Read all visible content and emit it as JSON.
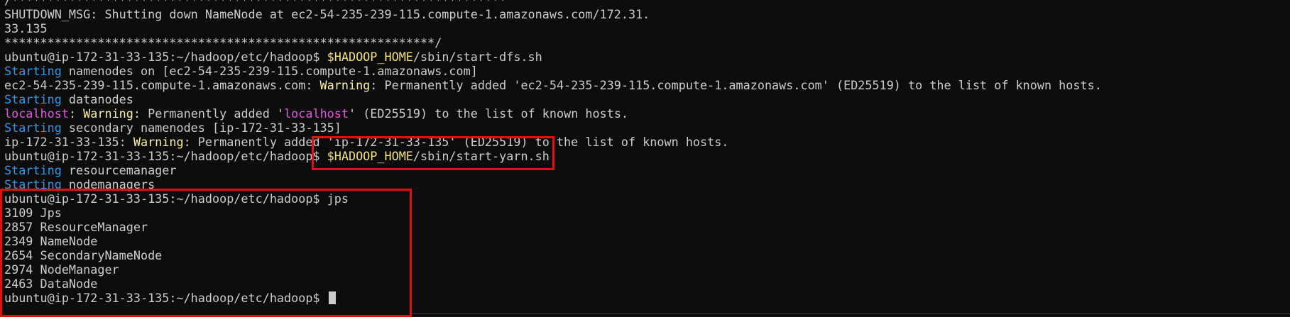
{
  "terminal": {
    "lines": [
      [
        {
          "t": "/*********************************************************************",
          "c": "fg"
        }
      ],
      [
        {
          "t": "SHUTDOWN_MSG: Shutting down NameNode at ec2-54-235-239-115.compute-1.amazonaws.com/172.31.",
          "c": "fg"
        }
      ],
      [
        {
          "t": "33.135",
          "c": "fg"
        }
      ],
      [
        {
          "t": "************************************************************/",
          "c": "fg"
        }
      ],
      [
        {
          "t": "ubuntu@ip-172-31-33-135:~/hadoop/etc/hadoop$ ",
          "c": "fg"
        },
        {
          "t": "$HADOOP_HOME",
          "c": "env"
        },
        {
          "t": "/sbin/start-dfs.sh",
          "c": "fg"
        }
      ],
      [
        {
          "t": "Starting",
          "c": "blue"
        },
        {
          "t": " namenodes on [ec2-54-235-239-115.compute-1.amazonaws.com]",
          "c": "fg"
        }
      ],
      [
        {
          "t": "ec2-54-235-239-115.compute-1.amazonaws.com: ",
          "c": "fg"
        },
        {
          "t": "Warning",
          "c": "yellow"
        },
        {
          "t": ": Permanently added 'ec2-54-235-239-115.compute-1.amazonaws.com' (ED25519) to the list of known hosts.",
          "c": "fg"
        }
      ],
      [
        {
          "t": "Starting",
          "c": "blue"
        },
        {
          "t": " datanodes",
          "c": "fg"
        }
      ],
      [
        {
          "t": "localhost",
          "c": "magenta"
        },
        {
          "t": ": ",
          "c": "fg"
        },
        {
          "t": "Warning",
          "c": "yellow"
        },
        {
          "t": ": Permanently added '",
          "c": "fg"
        },
        {
          "t": "localhost",
          "c": "magenta"
        },
        {
          "t": "' (ED25519) to the list of known hosts.",
          "c": "fg"
        }
      ],
      [
        {
          "t": "Starting",
          "c": "blue"
        },
        {
          "t": " secondary namenodes [ip-172-31-33-135]",
          "c": "fg"
        }
      ],
      [
        {
          "t": "ip-172-31-33-135: ",
          "c": "fg"
        },
        {
          "t": "Warning",
          "c": "yellow"
        },
        {
          "t": ": Permanently added 'ip-172-31-33-135' (ED25519) to the list of known hosts.",
          "c": "fg"
        }
      ],
      [
        {
          "t": "ubuntu@ip-172-31-33-135:~/hadoop/etc/hadoop$ ",
          "c": "fg"
        },
        {
          "t": "$HADOOP_HOME",
          "c": "env"
        },
        {
          "t": "/sbin/start-yarn.sh",
          "c": "fg"
        }
      ],
      [
        {
          "t": "Starting",
          "c": "blue"
        },
        {
          "t": " resourcemanager",
          "c": "fg"
        }
      ],
      [
        {
          "t": "Starting",
          "c": "blue"
        },
        {
          "t": " nodemanagers",
          "c": "fg"
        }
      ],
      [
        {
          "t": "ubuntu@ip-172-31-33-135:~/hadoop/etc/hadoop$ jps",
          "c": "fg"
        }
      ],
      [
        {
          "t": "3109 Jps",
          "c": "fg"
        }
      ],
      [
        {
          "t": "2857 ResourceManager",
          "c": "fg"
        }
      ],
      [
        {
          "t": "2349 NameNode",
          "c": "fg"
        }
      ],
      [
        {
          "t": "2654 SecondaryNameNode",
          "c": "fg"
        }
      ],
      [
        {
          "t": "2974 NodeManager",
          "c": "fg"
        }
      ],
      [
        {
          "t": "2463 DataNode",
          "c": "fg"
        }
      ],
      [
        {
          "t": "ubuntu@ip-172-31-33-135:~/hadoop/etc/hadoop$ ",
          "c": "fg"
        }
      ]
    ],
    "cursor_line_index": 21
  },
  "colors": {
    "background": "#0c0c0c",
    "foreground": "#cccccc",
    "blue": "#3a96dd",
    "yellow": "#f9f1a5",
    "magenta": "#e05ae0",
    "env": "#f2e27a",
    "highlight": "#e01010"
  }
}
